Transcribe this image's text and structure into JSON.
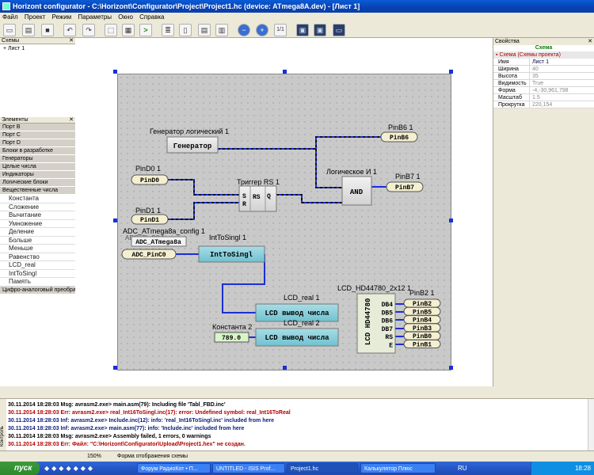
{
  "window": {
    "title": "Horizont configurator - C:\\Horizont\\Configurator\\Project\\Project1.hc  (device: ATmega8A.dev) - [Лист 1]"
  },
  "menu": [
    "Файл",
    "Проект",
    "Режим",
    "Параметры",
    "Окно",
    "Справка"
  ],
  "left": {
    "scheme_header": "Схемы",
    "scheme_item": "+ Лист 1",
    "elements_header": "Элементы",
    "categories": [
      "Порт B",
      "Порт C",
      "Порт D",
      "Блоки в разработке",
      "Генераторы",
      "Целые числа",
      "Индикаторы",
      "Логические блоки",
      "Вещественные числа"
    ],
    "subitems": [
      "Константа",
      "Сложение",
      "Вычитание",
      "Умножение",
      "Деление",
      "Больше",
      "Меньше",
      "Равенство",
      "LCD_real",
      "IntToSingl",
      "Память"
    ],
    "last_category": "Цифро-аналоговый преобразо"
  },
  "scheme": {
    "blocks": {
      "gen_title": "Генератор логический 1",
      "gen_label": "Генератор",
      "trig_title": "Триггер RS 1",
      "trig_s": "S",
      "trig_r": "R",
      "trig_rs": "RS",
      "trig_q": "Q",
      "and_title": "Логическое И 1",
      "and_label": "AND",
      "pinb6_title": "PinB6 1",
      "pinb6": "PinB6",
      "pinb7_title": "PinB7 1",
      "pinb7": "PinB7",
      "pind0_title": "PinD0 1",
      "pind0": "PinD0",
      "pind1_title": "PinD1 1",
      "pind1": "PinD1",
      "adc_title": "ADC_ATmega8a_config 1",
      "adc_label": "ADC_ATmega8a",
      "adc_pin_title": "ADC_PinC0 1",
      "adc_pin": "ADC_PinC0",
      "its_title": "IntToSingl 1",
      "its_label": "IntToSingl",
      "lcdr1_title": "LCD_real 1",
      "lcdr1_label": "LCD вывод числа",
      "lcdr2_title": "LCD_real 2",
      "lcdr2_label": "LCD вывод числа",
      "const_title": "Константа 2",
      "const_value": "789.0",
      "lcd_title": "LCD_HD44780_2x12 1",
      "lcd_vert": "LCD HD44780",
      "lcd_pins": [
        "DB4",
        "DB5",
        "DB6",
        "DB7",
        "RS",
        "E"
      ],
      "pinb2_title": "PinB2 1",
      "pinb_outs": [
        "PinB2",
        "PinB5",
        "PinB4",
        "PinB3",
        "PinB0",
        "PinB1"
      ]
    }
  },
  "props": {
    "header": "Свойства",
    "group": "Схема",
    "category": "Схема (Схемы проекта)",
    "rows": [
      {
        "k": "Имя",
        "v": "Лист 1",
        "dark": true
      },
      {
        "k": "Ширина",
        "v": "40"
      },
      {
        "k": "Высота",
        "v": "35"
      },
      {
        "k": "Видимость",
        "v": "True"
      },
      {
        "k": "Форма",
        "v": "-4,-30,961,798"
      },
      {
        "k": "Масштаб",
        "v": "1.5"
      },
      {
        "k": "Прокрутка",
        "v": "220,154"
      }
    ]
  },
  "log": {
    "side_label": "Контроль",
    "lines": [
      {
        "text": "30.11.2014 18:28:03 Msg: avrasm2.exe> main.asm(79): Including file 'Tabl_FBD.inc'",
        "cls": "log-msg"
      },
      {
        "text": "30.11.2014 18:28:03 Err:  avrasm2.exe> real_Int16ToSingl.inc(17): error: Undefined symbol: real_Int16ToReal",
        "cls": "log-err"
      },
      {
        "text": "30.11.2014 18:28:03 Inf:  avrasm2.exe> Include.inc(12): info: 'real_Int16ToSingl.inc' included from here",
        "cls": "log-inf"
      },
      {
        "text": "30.11.2014 18:28:03 Inf:  avrasm2.exe> main.asm(77): info: 'Include.inc' included from here",
        "cls": "log-inf"
      },
      {
        "text": "30.11.2014 18:28:03 Msg: avrasm2.exe> Assembly failed, 1 errors, 0 warnings",
        "cls": "log-msg"
      },
      {
        "text": "30.11.2014 18:28:03 Err:    Файл: \"C:\\Horizont\\Configurator\\Upload\\Project1.hex\" не создан.",
        "cls": "log-err"
      }
    ]
  },
  "status": {
    "zoom": "150%",
    "mode": "Форма отображения схемы"
  },
  "taskbar": {
    "start": "пуск",
    "items": [
      "Форум РадиоКот • П...",
      "UNTITLED - ISIS Prof...",
      "Project1.hc",
      "Калькулятор Плюс"
    ],
    "lang": "RU",
    "clock": "18:28"
  }
}
